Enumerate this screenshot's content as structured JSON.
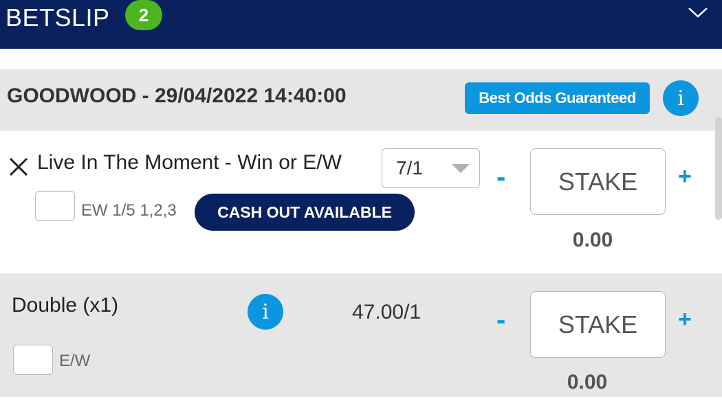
{
  "header": {
    "title": "BETSLIP",
    "count": "2",
    "collapse_icon": "chevron-down-icon"
  },
  "event": {
    "title": "GOODWOOD - 29/04/2022 14:40:00",
    "badge": "Best Odds Guaranteed",
    "info_icon": "i"
  },
  "selection": {
    "remove_icon": "close-icon",
    "label": "Live In The Moment - Win or E/W",
    "odds": "7/1",
    "each_way_label": "EW 1/5 1,2,3",
    "cashout_label": "CASH OUT AVAILABLE",
    "minus_label": "-",
    "plus_label": "+",
    "stake_placeholder": "STAKE",
    "amount": "0.00"
  },
  "double": {
    "label": "Double (x1)",
    "info_icon": "i",
    "odds": "47.00/1",
    "each_way_label": "E/W",
    "minus_label": "-",
    "plus_label": "+",
    "stake_placeholder": "STAKE",
    "amount": "0.00"
  },
  "colors": {
    "header_bg": "#0a2160",
    "badge_green": "#4cb520",
    "accent_blue": "#0d96e0",
    "row_grey": "#e6e6e6"
  }
}
